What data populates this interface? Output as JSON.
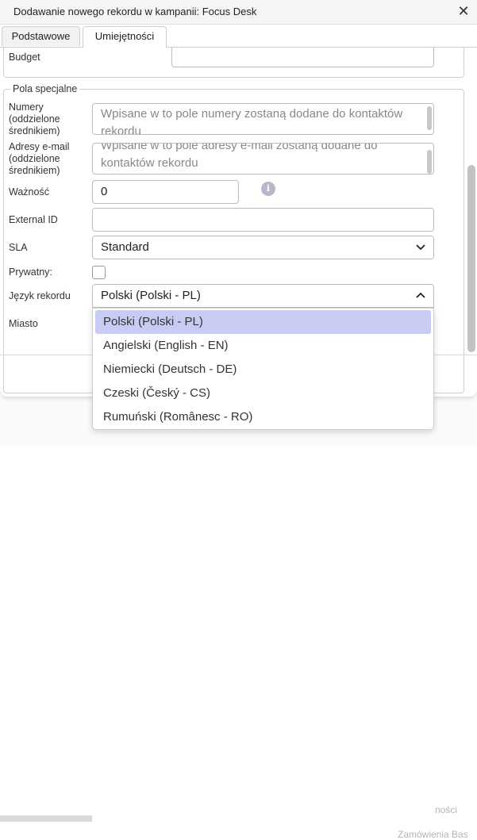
{
  "dialog": {
    "title": "Dodawanie nowego rekordu w kampanii: Focus Desk",
    "close_icon": "close-icon"
  },
  "tabs": [
    {
      "label": "Podstawowe",
      "active": false
    },
    {
      "label": "Umiejętności",
      "active": true
    }
  ],
  "fields": {
    "budget_label": "Budget",
    "budget_value": "",
    "special_legend": "Pola specjalne",
    "numbers_label": "Numery\n(oddzielone\nśrednikiem)",
    "numbers_placeholder": "Wpisane w to pole numery zostaną dodane do kontaktów rekordu",
    "emails_label": "Adresy e-mail\n(oddzielone\nśrednikiem)",
    "emails_placeholder": "Wpisane w to pole adresy e-mail zostaną dodane do kontaktów rekordu",
    "validity_label": "Ważność",
    "validity_value": "0",
    "external_id_label": "External ID",
    "external_id_value": "",
    "sla_label": "SLA",
    "sla_value": "Standard",
    "private_label": "Prywatny:",
    "private_checked": false,
    "language_label": "Język rekordu",
    "language_value": "Polski (Polski - PL)",
    "city_label": "Miasto"
  },
  "language_options": [
    "Polski (Polski - PL)",
    "Angielski (English - EN)",
    "Niemiecki (Deutsch - DE)",
    "Czeski (Český - CS)",
    "Rumuński (Românesc - RO)"
  ],
  "background": {
    "text_1": "ności",
    "text_2": "Zamówienia Bas"
  },
  "colors": {
    "selected_option": "#c9ccf2",
    "info_icon": "#b9b7c8"
  }
}
